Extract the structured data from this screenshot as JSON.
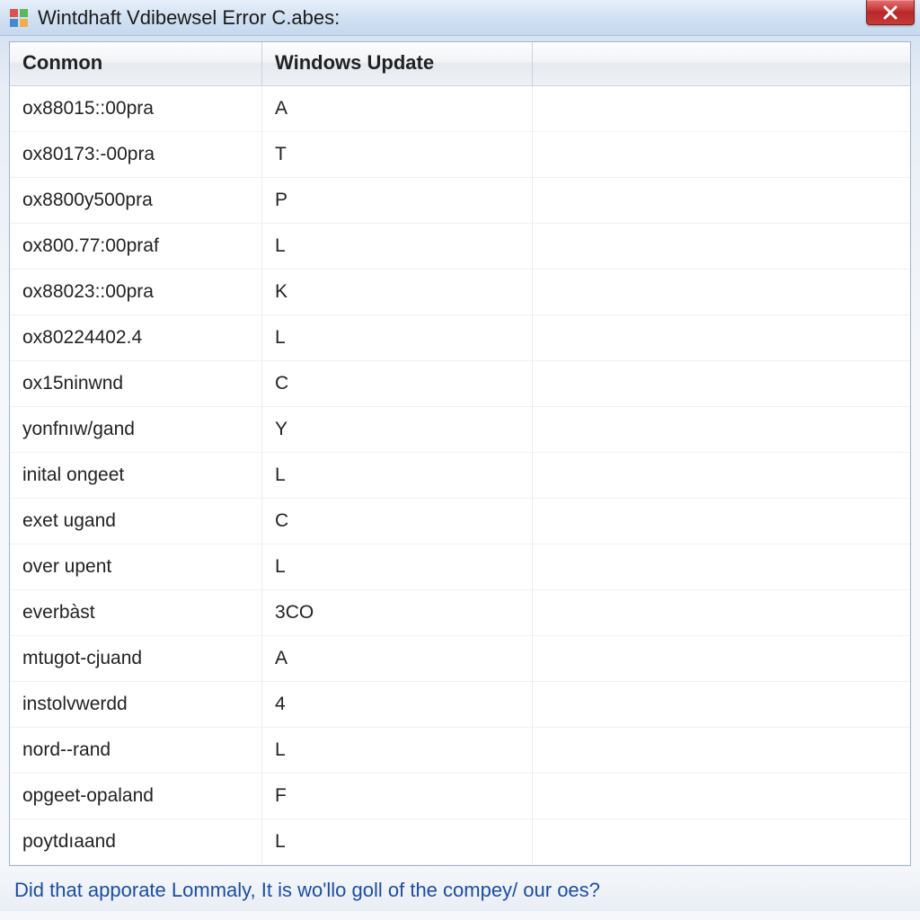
{
  "titlebar": {
    "title": "Wintdhaft Vdibewsel Error C.abes:"
  },
  "table": {
    "columns": [
      "Conmon",
      "Windows Update",
      ""
    ],
    "rows": [
      {
        "c1": "ox88015::00pra",
        "c2": "A",
        "c3": ""
      },
      {
        "c1": "ox80173:-00pra",
        "c2": "T",
        "c3": ""
      },
      {
        "c1": "ox8800y500pra",
        "c2": "P",
        "c3": ""
      },
      {
        "c1": "ox800.77:00praf",
        "c2": "L",
        "c3": ""
      },
      {
        "c1": "ox88023::00pra",
        "c2": "K",
        "c3": ""
      },
      {
        "c1": "ox80224402.4",
        "c2": "L",
        "c3": ""
      },
      {
        "c1": "ox15ninwnd",
        "c2": "C",
        "c3": ""
      },
      {
        "c1": "yonfnıw/gand",
        "c2": "Y",
        "c3": ""
      },
      {
        "c1": "inital ongeet",
        "c2": "L",
        "c3": ""
      },
      {
        "c1": "exet ugand",
        "c2": "C",
        "c3": ""
      },
      {
        "c1": "over upent",
        "c2": "L",
        "c3": ""
      },
      {
        "c1": "everbàst",
        "c2": "3CO",
        "c3": ""
      },
      {
        "c1": "mtugot-cjuand",
        "c2": "A",
        "c3": ""
      },
      {
        "c1": "instolvwerdd",
        "c2": "4",
        "c3": ""
      },
      {
        "c1": "nord--rand",
        "c2": "L",
        "c3": ""
      },
      {
        "c1": "opgeet-opaland",
        "c2": "F",
        "c3": ""
      },
      {
        "c1": "poytdıaand",
        "c2": "L",
        "c3": ""
      }
    ]
  },
  "footer": {
    "link_text": "Did that apporate Lommaly, It is wo'llo goll of the compey/ our oes?"
  }
}
